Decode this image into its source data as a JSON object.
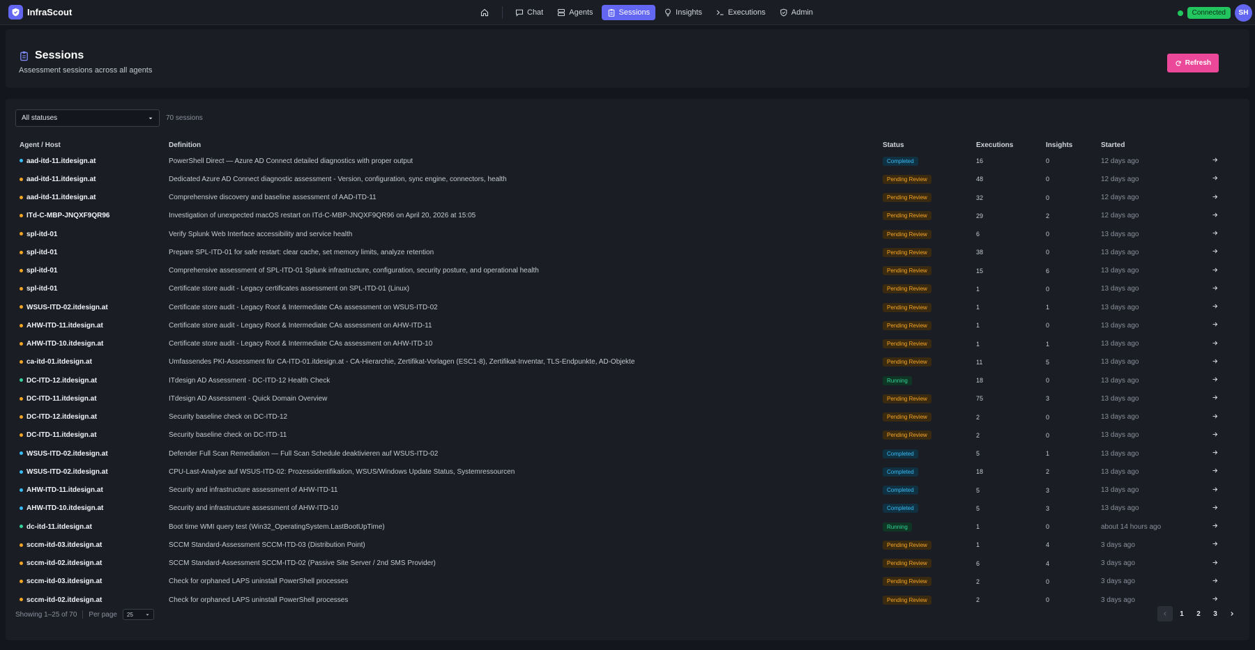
{
  "app": {
    "name": "InfraScout"
  },
  "nav": {
    "items": [
      {
        "label": "Chat",
        "icon": "chat-icon",
        "active": false
      },
      {
        "label": "Agents",
        "icon": "server-icon",
        "active": false
      },
      {
        "label": "Sessions",
        "icon": "clipboard-icon",
        "active": true
      },
      {
        "label": "Insights",
        "icon": "lightbulb-icon",
        "active": false
      },
      {
        "label": "Executions",
        "icon": "terminal-icon",
        "active": false
      },
      {
        "label": "Admin",
        "icon": "shield-icon",
        "active": false
      }
    ],
    "status": "Connected",
    "avatar_initials": "SH"
  },
  "header": {
    "title": "Sessions",
    "subtitle": "Assessment sessions across all agents",
    "refresh_label": "Refresh"
  },
  "filter": {
    "status_value": "All statuses",
    "count_label": "70 sessions"
  },
  "table": {
    "columns": [
      "Agent / Host",
      "Definition",
      "Status",
      "Executions",
      "Insights",
      "Started"
    ],
    "rows": [
      {
        "agent": "aad-itd-11.itdesign.at",
        "definition": "PowerShell Direct — Azure AD Connect detailed diagnostics with proper output",
        "status": "Completed",
        "executions": "16",
        "insights": "0",
        "started": "12 days ago"
      },
      {
        "agent": "aad-itd-11.itdesign.at",
        "definition": "Dedicated Azure AD Connect diagnostic assessment - Version, configuration, sync engine, connectors, health",
        "status": "Pending Review",
        "executions": "48",
        "insights": "0",
        "started": "12 days ago"
      },
      {
        "agent": "aad-itd-11.itdesign.at",
        "definition": "Comprehensive discovery and baseline assessment of AAD-ITD-11",
        "status": "Pending Review",
        "executions": "32",
        "insights": "0",
        "started": "12 days ago"
      },
      {
        "agent": "ITd-C-MBP-JNQXF9QR96",
        "definition": "Investigation of unexpected macOS restart on ITd-C-MBP-JNQXF9QR96 on April 20, 2026 at 15:05",
        "status": "Pending Review",
        "executions": "29",
        "insights": "2",
        "started": "12 days ago"
      },
      {
        "agent": "spl-itd-01",
        "definition": "Verify Splunk Web Interface accessibility and service health",
        "status": "Pending Review",
        "executions": "6",
        "insights": "0",
        "started": "13 days ago"
      },
      {
        "agent": "spl-itd-01",
        "definition": "Prepare SPL-ITD-01 for safe restart: clear cache, set memory limits, analyze retention",
        "status": "Pending Review",
        "executions": "38",
        "insights": "0",
        "started": "13 days ago"
      },
      {
        "agent": "spl-itd-01",
        "definition": "Comprehensive assessment of SPL-ITD-01 Splunk infrastructure, configuration, security posture, and operational health",
        "status": "Pending Review",
        "executions": "15",
        "insights": "6",
        "started": "13 days ago"
      },
      {
        "agent": "spl-itd-01",
        "definition": "Certificate store audit - Legacy certificates assessment on SPL-ITD-01 (Linux)",
        "status": "Pending Review",
        "executions": "1",
        "insights": "0",
        "started": "13 days ago"
      },
      {
        "agent": "WSUS-ITD-02.itdesign.at",
        "definition": "Certificate store audit - Legacy Root & Intermediate CAs assessment on WSUS-ITD-02",
        "status": "Pending Review",
        "executions": "1",
        "insights": "1",
        "started": "13 days ago"
      },
      {
        "agent": "AHW-ITD-11.itdesign.at",
        "definition": "Certificate store audit - Legacy Root & Intermediate CAs assessment on AHW-ITD-11",
        "status": "Pending Review",
        "executions": "1",
        "insights": "0",
        "started": "13 days ago"
      },
      {
        "agent": "AHW-ITD-10.itdesign.at",
        "definition": "Certificate store audit - Legacy Root & Intermediate CAs assessment on AHW-ITD-10",
        "status": "Pending Review",
        "executions": "1",
        "insights": "1",
        "started": "13 days ago"
      },
      {
        "agent": "ca-itd-01.itdesign.at",
        "definition": "Umfassendes PKI-Assessment für CA-ITD-01.itdesign.at - CA-Hierarchie, Zertifikat-Vorlagen (ESC1-8), Zertifikat-Inventar, TLS-Endpunkte, AD-Objekte",
        "status": "Pending Review",
        "executions": "11",
        "insights": "5",
        "started": "13 days ago"
      },
      {
        "agent": "DC-ITD-12.itdesign.at",
        "definition": "ITdesign AD Assessment - DC-ITD-12 Health Check",
        "status": "Running",
        "executions": "18",
        "insights": "0",
        "started": "13 days ago"
      },
      {
        "agent": "DC-ITD-11.itdesign.at",
        "definition": "ITdesign AD Assessment - Quick Domain Overview",
        "status": "Pending Review",
        "executions": "75",
        "insights": "3",
        "started": "13 days ago"
      },
      {
        "agent": "DC-ITD-12.itdesign.at",
        "definition": "Security baseline check on DC-ITD-12",
        "status": "Pending Review",
        "executions": "2",
        "insights": "0",
        "started": "13 days ago"
      },
      {
        "agent": "DC-ITD-11.itdesign.at",
        "definition": "Security baseline check on DC-ITD-11",
        "status": "Pending Review",
        "executions": "2",
        "insights": "0",
        "started": "13 days ago"
      },
      {
        "agent": "WSUS-ITD-02.itdesign.at",
        "definition": "Defender Full Scan Remediation — Full Scan Schedule deaktivieren auf WSUS-ITD-02",
        "status": "Completed",
        "executions": "5",
        "insights": "1",
        "started": "13 days ago"
      },
      {
        "agent": "WSUS-ITD-02.itdesign.at",
        "definition": "CPU-Last-Analyse auf WSUS-ITD-02: Prozessidentifikation, WSUS/Windows Update Status, Systemressourcen",
        "status": "Completed",
        "executions": "18",
        "insights": "2",
        "started": "13 days ago"
      },
      {
        "agent": "AHW-ITD-11.itdesign.at",
        "definition": "Security and infrastructure assessment of AHW-ITD-11",
        "status": "Completed",
        "executions": "5",
        "insights": "3",
        "started": "13 days ago"
      },
      {
        "agent": "AHW-ITD-10.itdesign.at",
        "definition": "Security and infrastructure assessment of AHW-ITD-10",
        "status": "Completed",
        "executions": "5",
        "insights": "3",
        "started": "13 days ago"
      },
      {
        "agent": "dc-itd-11.itdesign.at",
        "definition": "Boot time WMI query test (Win32_OperatingSystem.LastBootUpTime)",
        "status": "Running",
        "executions": "1",
        "insights": "0",
        "started": "about 14 hours ago"
      },
      {
        "agent": "sccm-itd-03.itdesign.at",
        "definition": "SCCM Standard-Assessment SCCM-ITD-03 (Distribution Point)",
        "status": "Pending Review",
        "executions": "1",
        "insights": "4",
        "started": "3 days ago"
      },
      {
        "agent": "sccm-itd-02.itdesign.at",
        "definition": "SCCM Standard-Assessment SCCM-ITD-02 (Passive Site Server / 2nd SMS Provider)",
        "status": "Pending Review",
        "executions": "6",
        "insights": "4",
        "started": "3 days ago"
      },
      {
        "agent": "sccm-itd-03.itdesign.at",
        "definition": "Check for orphaned LAPS uninstall PowerShell processes",
        "status": "Pending Review",
        "executions": "2",
        "insights": "0",
        "started": "3 days ago"
      },
      {
        "agent": "sccm-itd-02.itdesign.at",
        "definition": "Check for orphaned LAPS uninstall PowerShell processes",
        "status": "Pending Review",
        "executions": "2",
        "insights": "0",
        "started": "3 days ago"
      }
    ]
  },
  "footer": {
    "showing": "Showing 1–25 of 70",
    "per_page_label": "Per page",
    "per_page_value": "25",
    "pages": [
      "1",
      "2",
      "3"
    ]
  },
  "colors": {
    "accent": "#6366f1",
    "refresh": "#ec4899",
    "completed": "#38bdf8",
    "pending": "#f5a524",
    "running": "#34d399"
  }
}
